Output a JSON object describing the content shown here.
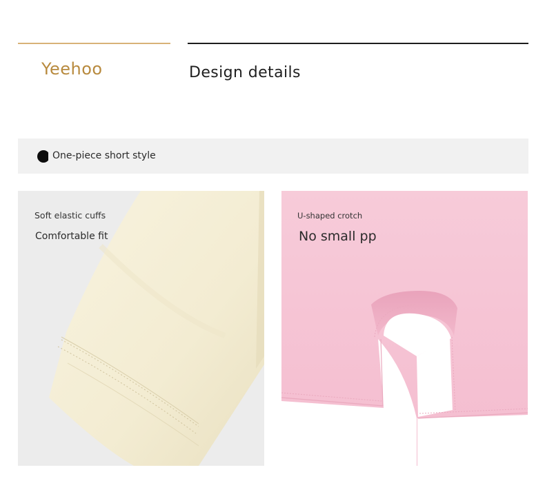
{
  "header": {
    "brand": "Yeehoo",
    "title": "Design details"
  },
  "banner": {
    "label": "One-piece short style"
  },
  "features": [
    {
      "caption": "Soft elastic cuffs",
      "subtitle": "Comfortable fit"
    },
    {
      "caption": "U-shaped crotch",
      "subtitle": "No small pp"
    }
  ],
  "colors": {
    "brand": "#b88a3e",
    "brand_rule": "#d8b277",
    "banner_bg": "#f1f1f1",
    "cream_fabric": "#f6f0da",
    "pink_fabric": "#f7c9d8"
  },
  "icons": {
    "banner_bullet": "filled-circle"
  }
}
